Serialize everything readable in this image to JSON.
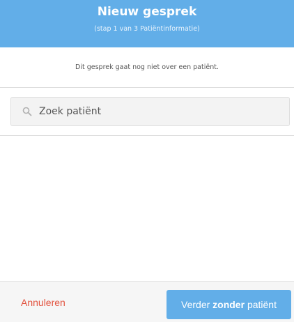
{
  "header": {
    "title": "Nieuw gesprek",
    "subtitle": "(stap 1 van 3 Patiëntinformatie)"
  },
  "info_text": "Dit gesprek gaat nog niet over een patiënt.",
  "search": {
    "placeholder": "Zoek patiënt",
    "value": ""
  },
  "footer": {
    "cancel_label": "Annuleren",
    "continue_prefix": "Verder",
    "continue_bold": "zonder",
    "continue_suffix": "patiënt"
  },
  "colors": {
    "accent": "#62aee8",
    "cancel": "#e2533f"
  }
}
